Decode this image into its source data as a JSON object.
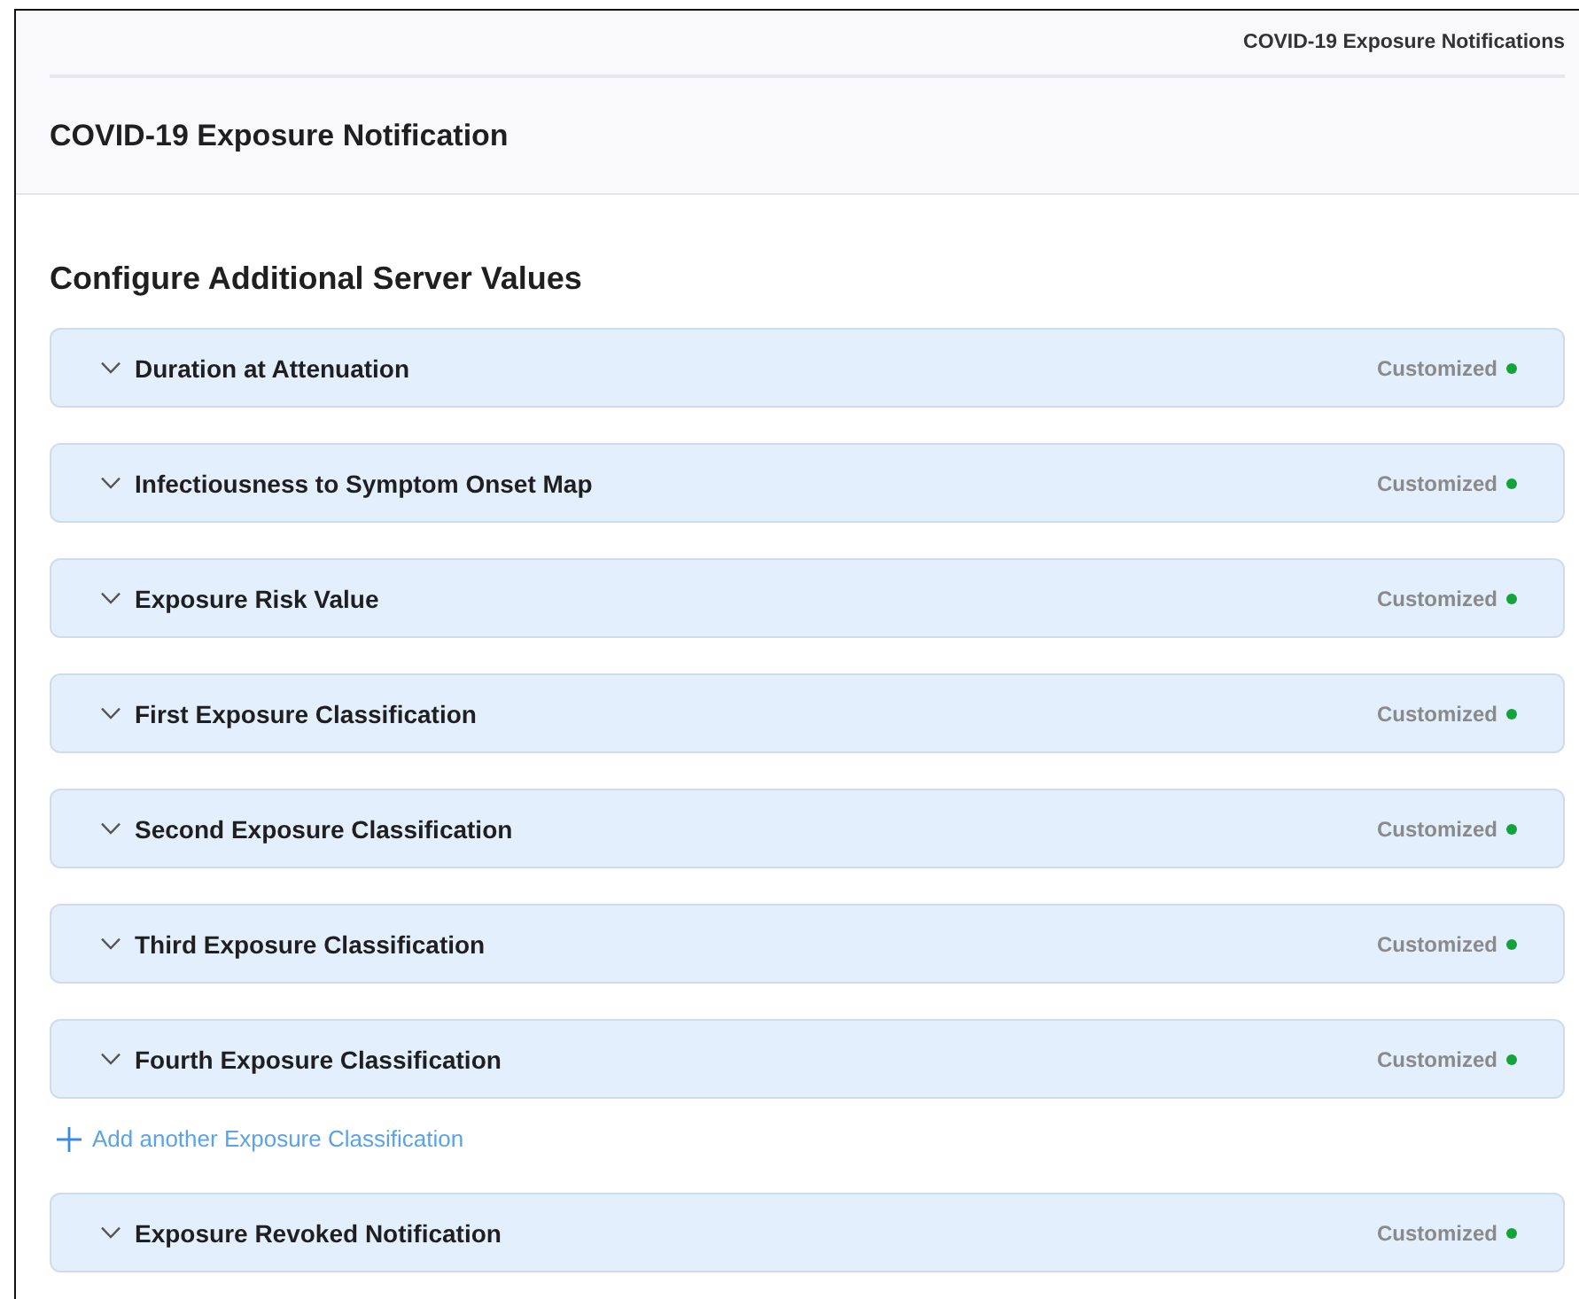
{
  "header": {
    "breadcrumb": "COVID-19 Exposure Notifications",
    "title": "COVID-19 Exposure Notification"
  },
  "section": {
    "title": "Configure Additional Server Values",
    "panels": [
      {
        "label": "Duration at Attenuation",
        "expanded": false,
        "status": "Customized",
        "color": "#12a33a"
      },
      {
        "label": "Infectiousness to Symptom Onset Map",
        "expanded": false,
        "status": "Customized",
        "color": "#12a33a"
      },
      {
        "label": "Exposure Risk Value",
        "expanded": false,
        "status": "Customized",
        "color": "#12a33a"
      },
      {
        "label": "First Exposure Classification",
        "expanded": false,
        "status": "Customized",
        "color": "#12a33a"
      },
      {
        "label": "Second Exposure Classification",
        "expanded": false,
        "status": "Customized",
        "color": "#12a33a"
      },
      {
        "label": "Third Exposure Classification",
        "expanded": false,
        "status": "Customized",
        "color": "#12a33a"
      },
      {
        "label": "Fourth Exposure Classification",
        "expanded": false,
        "status": "Customized",
        "color": "#12a33a"
      }
    ],
    "add_link": "Add another Exposure Classification",
    "more_panels": [
      {
        "label": "Exposure Revoked Notification",
        "expanded": false,
        "status": "Customized",
        "color": "#12a33a"
      }
    ]
  }
}
